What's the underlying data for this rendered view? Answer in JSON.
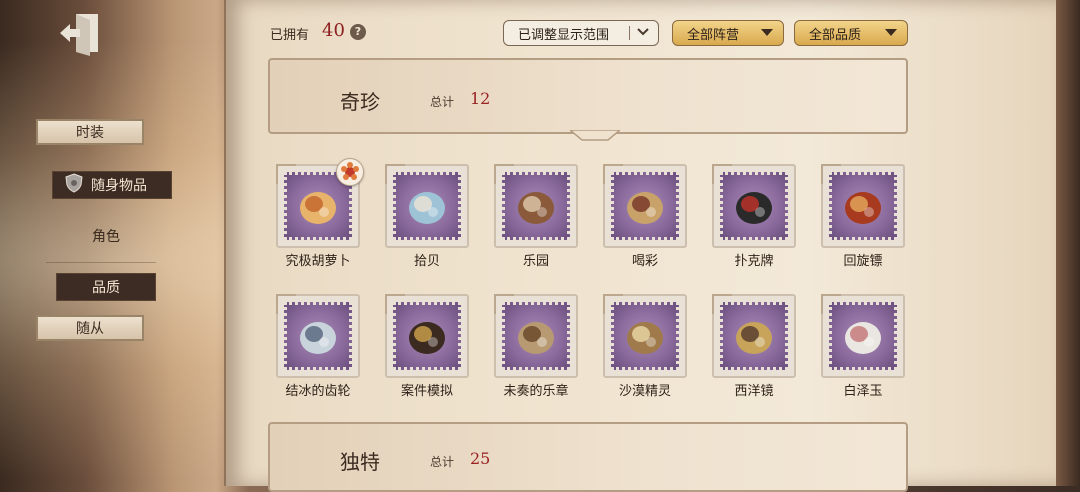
{
  "topbar": {
    "owned_label": "已拥有",
    "owned_count": "40",
    "help_icon": "?",
    "range_dropdown": "已调整显示范围",
    "camp_dropdown": "全部阵营",
    "quality_dropdown": "全部品质"
  },
  "sidebar": {
    "items": [
      {
        "label": "时装"
      },
      {
        "label": "随身物品"
      },
      {
        "label": "角色"
      },
      {
        "label": "品质"
      },
      {
        "label": "随从"
      }
    ]
  },
  "sections": [
    {
      "title": "奇珍",
      "total_label": "总计",
      "total": "12"
    },
    {
      "title": "独特",
      "total_label": "总计",
      "total": "25"
    }
  ],
  "items": [
    {
      "name": "究极胡萝卜",
      "icon": "carrot-jar-icon"
    },
    {
      "name": "拾贝",
      "icon": "shell-pearl-icon"
    },
    {
      "name": "乐园",
      "icon": "rabbit-toy-icon"
    },
    {
      "name": "喝彩",
      "icon": "mask-jester-icon"
    },
    {
      "name": "扑克牌",
      "icon": "card-box-icon"
    },
    {
      "name": "回旋镖",
      "icon": "boomerang-icon"
    },
    {
      "name": "结冰的齿轮",
      "icon": "frozen-gear-icon"
    },
    {
      "name": "案件模拟",
      "icon": "spinning-top-icon"
    },
    {
      "name": "未奏的乐章",
      "icon": "scroll-sheet-icon"
    },
    {
      "name": "沙漠精灵",
      "icon": "dragonfly-icon"
    },
    {
      "name": "西洋镜",
      "icon": "goblet-icon"
    },
    {
      "name": "白泽玉",
      "icon": "white-deer-icon"
    }
  ],
  "colors": {
    "accent_red": "#9a2222",
    "stamp_purple": "#8a6a9c",
    "gold": "#d9a94e"
  }
}
